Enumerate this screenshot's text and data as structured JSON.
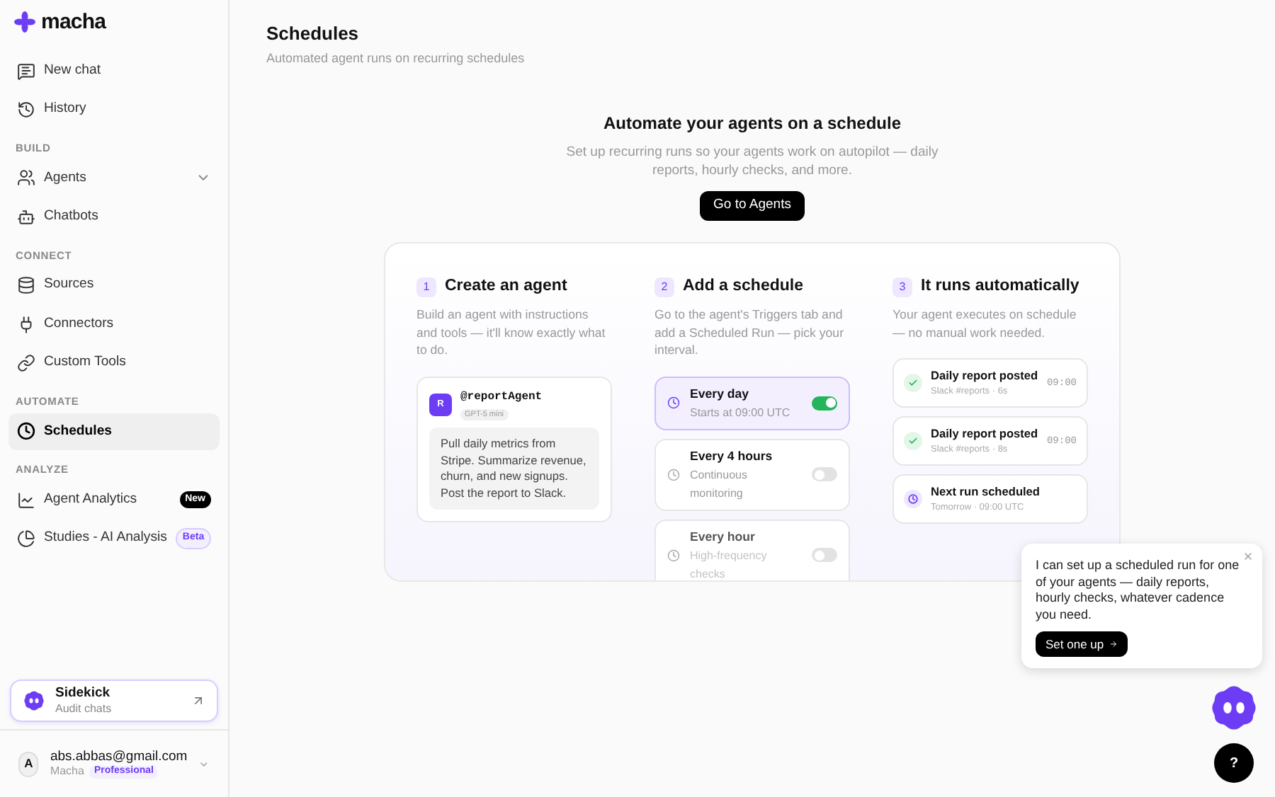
{
  "sidebar": {
    "logo": "macha",
    "top_items": [
      {
        "label": "New chat",
        "selected": false
      },
      {
        "label": "History",
        "selected": false
      }
    ],
    "sections": [
      {
        "heading": "BUILD",
        "items": [
          {
            "label": "Agents",
            "selected": false,
            "expandable": true
          },
          {
            "label": "Chatbots",
            "selected": false
          }
        ]
      },
      {
        "heading": "CONNECT",
        "items": [
          {
            "label": "Sources",
            "selected": false
          },
          {
            "label": "Connectors",
            "selected": false
          },
          {
            "label": "Custom Tools",
            "selected": false
          }
        ]
      },
      {
        "heading": "AUTOMATE",
        "items": [
          {
            "label": "Schedules",
            "selected": true
          }
        ]
      },
      {
        "heading": "ANALYZE",
        "items": [
          {
            "label": "Agent Analytics",
            "selected": false,
            "badge": {
              "text": "New",
              "kind": "dark"
            }
          },
          {
            "label": "Studies - AI Analysis",
            "selected": false,
            "badge": {
              "text": "Beta",
              "kind": "outline"
            }
          }
        ]
      }
    ],
    "sidekick": {
      "title": "Sidekick",
      "subtitle": "Audit chats"
    },
    "user": {
      "avatar": "A",
      "email": "abs.abbas@gmail.com",
      "org": "Macha",
      "plan": "Professional"
    }
  },
  "header": {
    "title": "Schedules",
    "subtitle": "Automated agent runs on recurring schedules"
  },
  "hero": {
    "title": "Automate your agents on a schedule",
    "text": "Set up recurring runs so your agents work on autopilot — daily reports, hourly checks, and more.",
    "button": "Go to Agents"
  },
  "steps": [
    {
      "number": "1",
      "title": "Create an agent",
      "text": "Build an agent with instructions and tools — it'll know exactly what to do.",
      "agent": {
        "avatar": "R",
        "name": "@reportAgent",
        "model": "GPT-5 mini",
        "prompt": "Pull daily metrics from Stripe. Summarize revenue, churn, and new signups. Post the report to Slack."
      }
    },
    {
      "number": "2",
      "title": "Add a schedule",
      "text": "Go to the agent's Triggers tab and add a Scheduled Run — pick your interval.",
      "schedules": [
        {
          "title": "Every day",
          "subtitle": "Starts at 09:00 UTC",
          "selected": true,
          "on": true
        },
        {
          "title": "Every 4 hours",
          "subtitle": "Continuous monitoring",
          "selected": false,
          "on": false
        },
        {
          "title": "Every hour",
          "subtitle": "High-frequency checks",
          "selected": false,
          "on": false
        }
      ]
    },
    {
      "number": "3",
      "title": "It runs automatically",
      "text": "Your agent executes on schedule — no manual work needed.",
      "runs": [
        {
          "kind": "done",
          "title": "Daily report posted",
          "subtitle": "Slack #reports · 6s",
          "time": "09:00"
        },
        {
          "kind": "done",
          "title": "Daily report posted",
          "subtitle": "Slack #reports · 8s",
          "time": "09:00"
        },
        {
          "kind": "scheduled",
          "title": "Next run scheduled",
          "subtitle": "Tomorrow · 09:00 UTC"
        }
      ]
    }
  ],
  "popup": {
    "text": "I can set up a scheduled run for one of your agents — daily reports, hourly checks, whatever cadence you need.",
    "button": "Set one up"
  },
  "help_button": "?"
}
